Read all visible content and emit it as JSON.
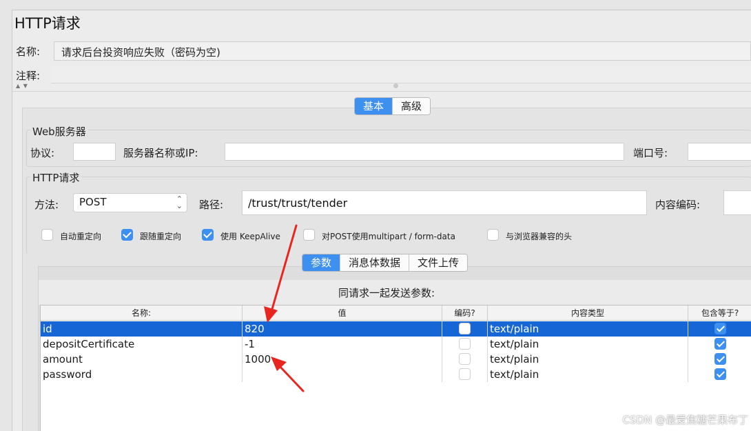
{
  "window": {
    "title": "HTTP请求"
  },
  "name_row": {
    "label": "名称:",
    "value": "请求后台投资响应失败（密码为空)"
  },
  "comment_row": {
    "label": "注释:",
    "value": ""
  },
  "top_tabs": [
    {
      "label": "基本",
      "active": true
    },
    {
      "label": "高级",
      "active": false
    }
  ],
  "web_server": {
    "group_title": "Web服务器",
    "protocol_label": "协议:",
    "protocol_value": "",
    "server_label": "服务器名称或IP:",
    "server_value": "",
    "port_label": "端口号:",
    "port_value": ""
  },
  "http_request": {
    "group_title": "HTTP请求",
    "method_label": "方法:",
    "method_value": "POST",
    "path_label": "路径:",
    "path_value": "/trust/trust/tender",
    "encoding_label": "内容编码:",
    "encoding_value": ""
  },
  "options": [
    {
      "label": "自动重定向",
      "checked": false
    },
    {
      "label": "跟随重定向",
      "checked": true
    },
    {
      "label": "使用 KeepAlive",
      "checked": true
    },
    {
      "label": "对POST使用multipart / form-data",
      "checked": false
    },
    {
      "label": "与浏览器兼容的头",
      "checked": false
    }
  ],
  "sub_tabs": [
    {
      "label": "参数",
      "active": true
    },
    {
      "label": "消息体数据",
      "active": false
    },
    {
      "label": "文件上传",
      "active": false
    }
  ],
  "params": {
    "caption": "同请求一起发送参数:",
    "columns": [
      "名称:",
      "值",
      "编码?",
      "内容类型",
      "包含等于?"
    ],
    "rows": [
      {
        "name": "id",
        "value": "820",
        "encode": false,
        "content_type": "text/plain",
        "include_equals": true,
        "selected": true
      },
      {
        "name": "depositCertificate",
        "value": "-1",
        "encode": false,
        "content_type": "text/plain",
        "include_equals": true,
        "selected": false
      },
      {
        "name": "amount",
        "value": "1000",
        "encode": false,
        "content_type": "text/plain",
        "include_equals": true,
        "selected": false
      },
      {
        "name": "password",
        "value": "",
        "encode": false,
        "content_type": "text/plain",
        "include_equals": true,
        "selected": false
      }
    ]
  },
  "watermark": "CSDN @最爱焦糖芒果布丁",
  "colors": {
    "accent": "#3d8ff0",
    "selection": "#1766d6",
    "annotation_arrow": "#e8261f"
  }
}
